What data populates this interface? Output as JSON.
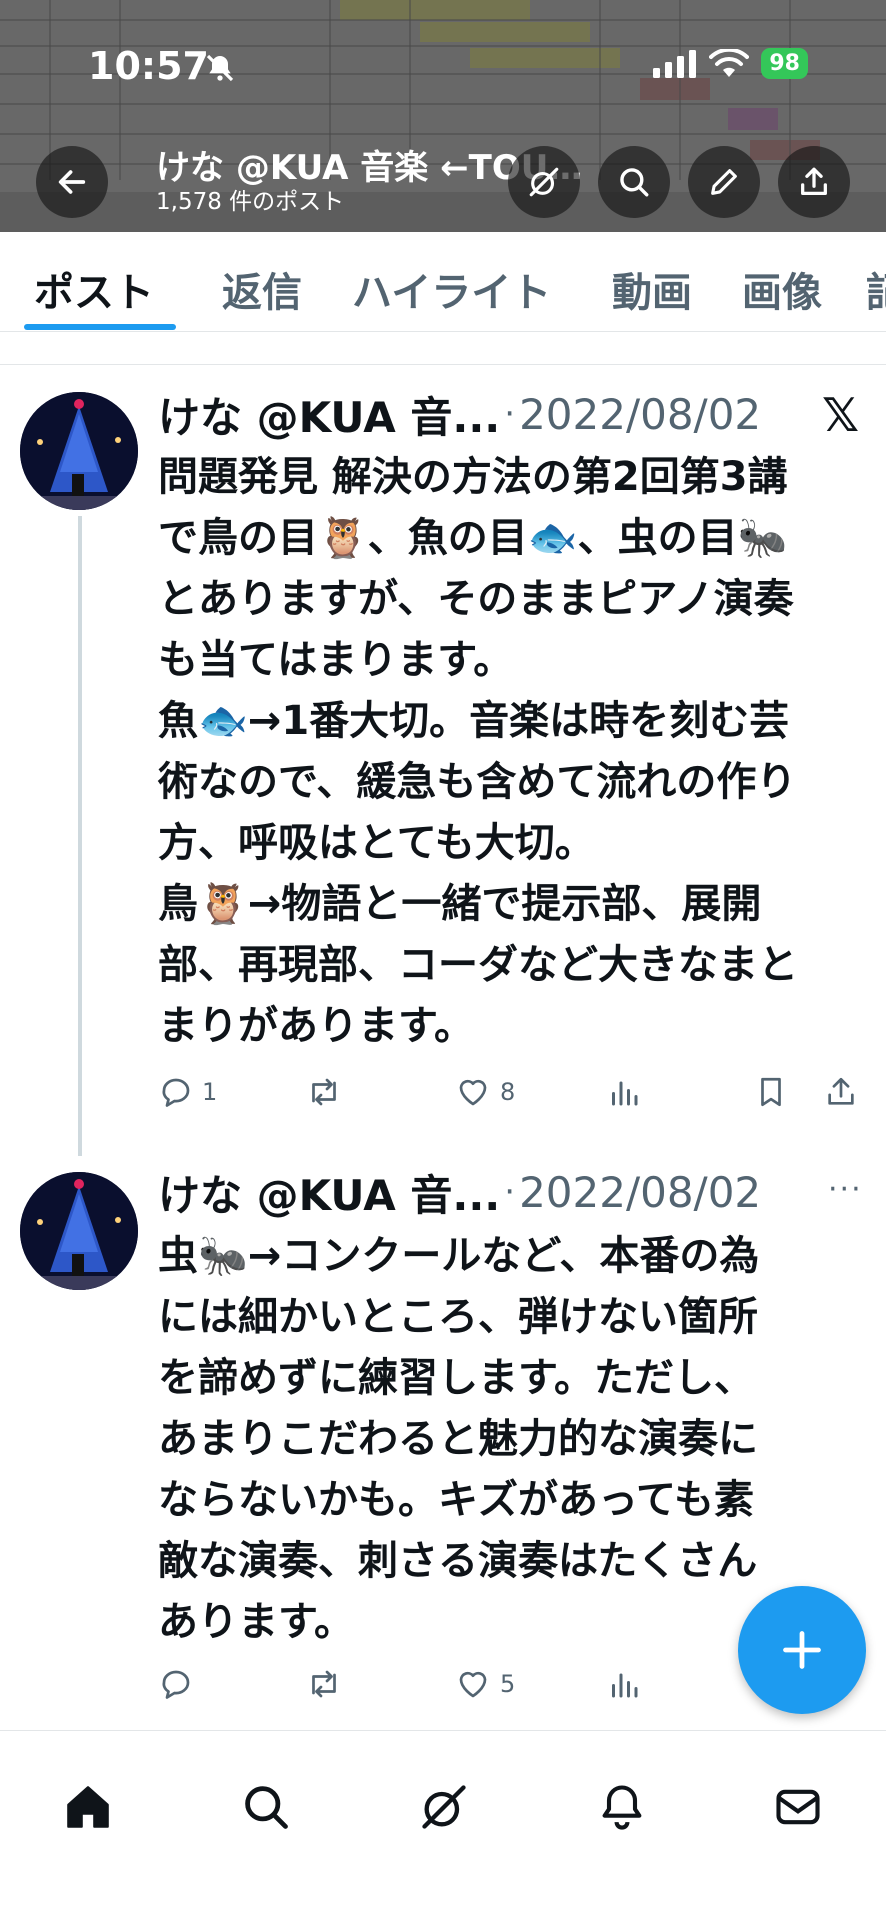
{
  "status_bar": {
    "time": "10:57",
    "battery": "98"
  },
  "header": {
    "title": "けな @KUA 音楽 ←TOU…",
    "post_count": "1,578 件のポスト"
  },
  "tabs": [
    {
      "label": "ポスト",
      "active": true
    },
    {
      "label": "返信",
      "active": false
    },
    {
      "label": "ハイライト",
      "active": false
    },
    {
      "label": "動画",
      "active": false
    },
    {
      "label": "画像",
      "active": false
    },
    {
      "label": "記",
      "active": false
    }
  ],
  "tweets": [
    {
      "author": "けな @KUA 音...",
      "separator": "·",
      "date": "2022/08/02",
      "lines": [
        "問題発見 解決の方法の第2回第3講",
        "で鳥の目🦉、魚の目🐟、虫の目🐜",
        "とありますが、そのままピアノ演奏",
        "も当てはまります。",
        "魚🐟→1番大切。音楽は時を刻む芸",
        "術なので、緩急も含めて流れの作り",
        "方、呼吸はとても大切。",
        "鳥🦉→物語と一緒で提示部、展開",
        "部、再現部、コーダなど大きなまと",
        "まりがあります。"
      ],
      "replies": "1",
      "reposts": "",
      "likes": "8"
    },
    {
      "author": "けな @KUA 音...",
      "separator": "·",
      "date": "2022/08/02",
      "lines": [
        "虫🐜→コンクールなど、本番の為",
        "には細かいところ、弾けない箇所",
        "を諦めずに練習します。ただし、",
        "あまりこだわると魅力的な演奏に",
        "ならないかも。キズがあっても素",
        "敵な演奏、刺さる演奏はたくさん",
        "あります。"
      ],
      "replies": "",
      "reposts": "",
      "likes": "5"
    }
  ],
  "icons": {
    "back": "back-arrow-icon",
    "grok": "grok-icon",
    "search": "search-icon",
    "edit": "pencil-icon",
    "share": "share-icon",
    "x_logo": "𝕏",
    "more": "···"
  },
  "colors": {
    "accent": "#1d9bf0",
    "text": "#0f1419",
    "muted": "#536471"
  }
}
